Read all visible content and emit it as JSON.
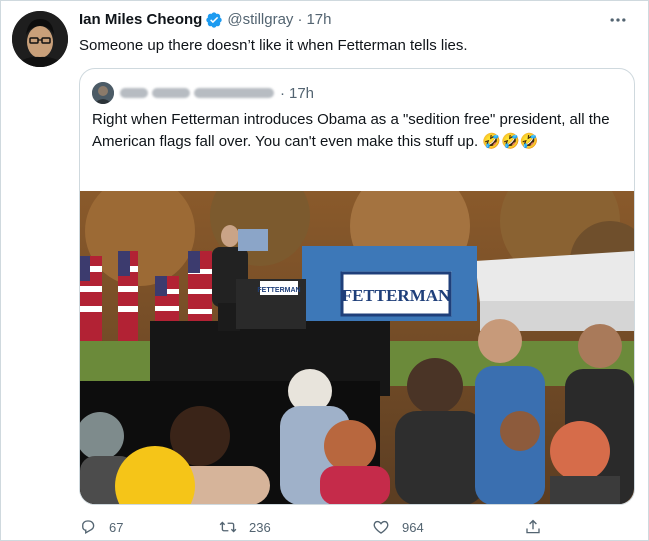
{
  "tweet": {
    "author_name": "Ian Miles Cheong",
    "handle": "@stillgray",
    "separator": "·",
    "time": "17h",
    "text": "Someone up there doesn’t like it when Fetterman tells lies.",
    "icons": [
      "avatar",
      "verified-badge-icon",
      "more-options-icon"
    ]
  },
  "quoted": {
    "separator": "·",
    "time": "17h",
    "text": "Right when Fetterman introduces Obama as a \"sedition free\" president, all the American flags fall over. You can't even make this stuff up. 🤣🤣🤣",
    "media": {
      "banner_text": "FETTERMAN",
      "podium_text": "FETTERMAN"
    }
  },
  "actions": {
    "reply_count": "67",
    "retweet_count": "236",
    "like_count": "964"
  },
  "colors": {
    "text_primary": "#0f1419",
    "text_secondary": "#536471",
    "verified": "#1d9bf0",
    "border": "#cfd9de"
  }
}
